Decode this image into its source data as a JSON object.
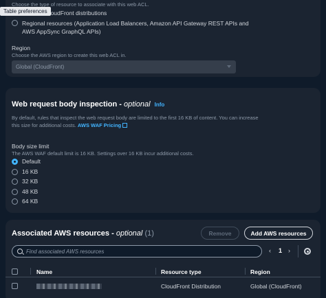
{
  "tooltip": "Table preferences",
  "resource_type": {
    "description": "Choose the type of resource to associate with this web ACL.",
    "options": [
      {
        "label": "Amazon CloudFront distributions",
        "selected": true
      },
      {
        "label_line1": "Regional resources (Application Load Balancers, Amazon API Gateway REST APIs and",
        "label_line2": "AWS AppSync GraphQL APIs)",
        "selected": false
      }
    ]
  },
  "region": {
    "label": "Region",
    "description": "Choose the AWS region to create this web ACL in.",
    "value": "Global (CloudFront)"
  },
  "body_inspection": {
    "title": "Web request body inspection -",
    "title_optional": "optional",
    "info": "Info",
    "description_line1": "By default, rules that inspect the web request body are limited to the first 16 KB of content. You can increase",
    "description_line2": "this size for additional costs.",
    "pricing_link": "AWS WAF Pricing",
    "size_label": "Body size limit",
    "size_desc": "The AWS WAF default limit is 16 KB. Settings over 16 KB incur additional costs.",
    "options": [
      {
        "label": "Default",
        "selected": true
      },
      {
        "label": "16 KB",
        "selected": false
      },
      {
        "label": "32 KB",
        "selected": false
      },
      {
        "label": "48 KB",
        "selected": false
      },
      {
        "label": "64 KB",
        "selected": false
      }
    ]
  },
  "associated": {
    "title": "Associated AWS resources -",
    "title_optional": "optional",
    "count": "(1)",
    "remove_label": "Remove",
    "add_label": "Add AWS resources",
    "search_placeholder": "Find associated AWS resources",
    "page": "1",
    "prev": "‹",
    "next": "›",
    "columns": [
      "Name",
      "Resource type",
      "Region"
    ],
    "rows": [
      {
        "resource_type": "CloudFront Distribution",
        "region": "Global (CloudFront)"
      }
    ]
  },
  "colors": {
    "accent": "#42b4ff",
    "panel": "#1b2431",
    "background": "#0f1b2a"
  },
  "icons": [
    "search-icon",
    "gear-icon",
    "external-link-icon",
    "chevron-left-icon",
    "chevron-right-icon",
    "caret-down-icon"
  ]
}
